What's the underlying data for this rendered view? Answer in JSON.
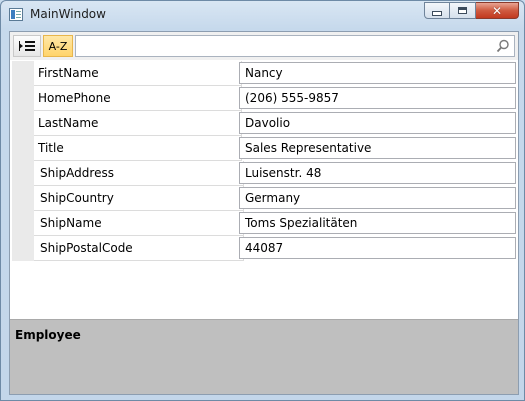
{
  "window": {
    "title": "MainWindow"
  },
  "toolbar": {
    "categorized_icon": "categorized-list-icon",
    "alphabetical_label": "A-Z",
    "search_value": "",
    "search_placeholder": "",
    "search_icon": "magnifier-icon",
    "active_button_color": "#ffd46a"
  },
  "properties": [
    {
      "name": "FirstName",
      "value": "Nancy"
    },
    {
      "name": "HomePhone",
      "value": "(206) 555-9857"
    },
    {
      "name": "LastName",
      "value": "Davolio"
    },
    {
      "name": "Title",
      "value": "Sales Representative"
    },
    {
      "name": "ShipAddress",
      "value": "Luisenstr. 48"
    },
    {
      "name": "ShipCountry",
      "value": "Germany"
    },
    {
      "name": "ShipName",
      "value": "Toms Spezialitäten"
    },
    {
      "name": "ShipPostalCode",
      "value": "44087"
    }
  ],
  "description": {
    "title": "Employee"
  },
  "colors": {
    "description_panel": "#bfbfbf",
    "close_button": "#c2391f"
  }
}
